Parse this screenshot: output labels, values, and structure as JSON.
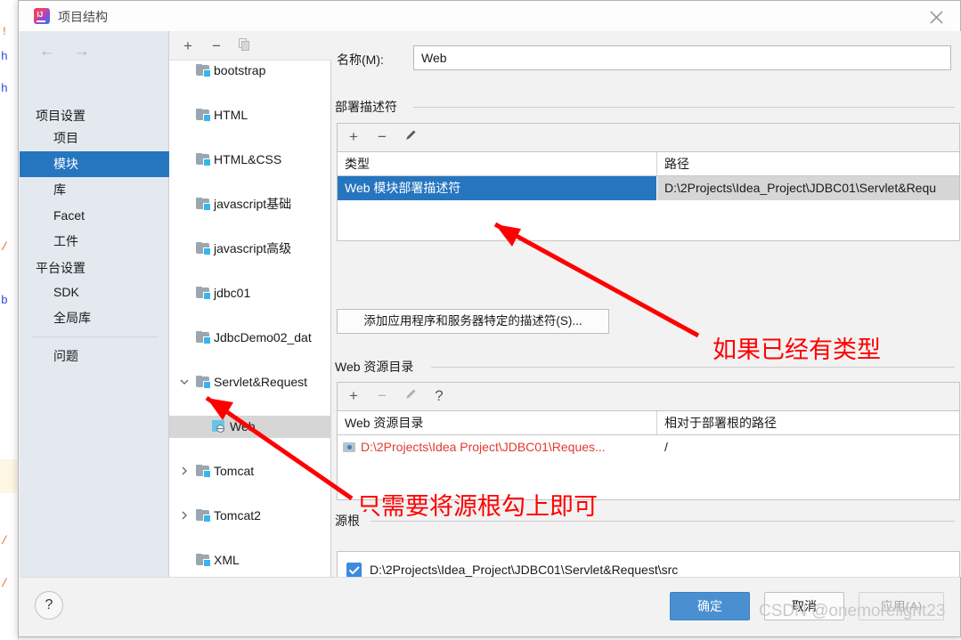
{
  "window": {
    "title": "项目结构",
    "app_icon": "intellij-idea-icon",
    "close_icon": "close-icon"
  },
  "sidebar": {
    "back_icon": "arrow-left-icon",
    "forward_icon": "arrow-right-icon",
    "groups": [
      {
        "label": "项目设置",
        "items": [
          "项目",
          "模块",
          "库",
          "Facet",
          "工件"
        ]
      },
      {
        "label": "平台设置",
        "items": [
          "SDK",
          "全局库"
        ]
      }
    ],
    "selected": "模块",
    "footer_item": "问题"
  },
  "tree": {
    "toolbar": {
      "add": "+",
      "remove": "−",
      "copy_icon": "copy-icon"
    },
    "items": [
      {
        "label": "bootstrap",
        "type": "module",
        "depth": 0,
        "twisty": "none"
      },
      {
        "label": "HTML",
        "type": "module",
        "depth": 0,
        "twisty": "none"
      },
      {
        "label": "HTML&CSS",
        "type": "module",
        "depth": 0,
        "twisty": "none"
      },
      {
        "label": "javascript基础",
        "type": "module",
        "depth": 0,
        "twisty": "none"
      },
      {
        "label": "javascript高级",
        "type": "module",
        "depth": 0,
        "twisty": "none"
      },
      {
        "label": "jdbc01",
        "type": "module",
        "depth": 0,
        "twisty": "none"
      },
      {
        "label": "JdbcDemo02_dat",
        "type": "module",
        "depth": 0,
        "twisty": "none"
      },
      {
        "label": "Servlet&Request",
        "type": "module",
        "depth": 0,
        "twisty": "expanded"
      },
      {
        "label": "Web",
        "type": "facet",
        "depth": 1,
        "twisty": "none",
        "selected": true
      },
      {
        "label": "Tomcat",
        "type": "module",
        "depth": 0,
        "twisty": "collapsed"
      },
      {
        "label": "Tomcat2",
        "type": "module",
        "depth": 0,
        "twisty": "collapsed"
      },
      {
        "label": "XML",
        "type": "module",
        "depth": 0,
        "twisty": "none"
      }
    ]
  },
  "main": {
    "name_label": "名称(M):",
    "name_value": "Web",
    "deployment": {
      "section_label": "部署描述符",
      "toolbar": {
        "add": "+",
        "remove": "−",
        "edit_icon": "pencil-icon"
      },
      "columns": [
        "类型",
        "路径"
      ],
      "rows": [
        {
          "type": "Web 模块部署描述符",
          "path": "D:\\2Projects\\Idea_Project\\JDBC01\\Servlet&Requ",
          "selected": true
        }
      ],
      "add_descriptor_button": "添加应用程序和服务器特定的描述符(S)..."
    },
    "web_resources": {
      "section_label": "Web 资源目录",
      "toolbar": {
        "add": "+",
        "remove": "−",
        "edit_icon": "pencil-icon",
        "help": "?"
      },
      "columns": [
        "Web 资源目录",
        "相对于部署根的路径"
      ],
      "rows": [
        {
          "directory": "D:\\2Projects\\Idea Project\\JDBC01\\Reques...",
          "relative_path": "/",
          "error": true
        }
      ]
    },
    "source_roots": {
      "section_label": "源根",
      "rows": [
        {
          "checked": true,
          "path": "D:\\2Projects\\Idea_Project\\JDBC01\\Servlet&Request\\src"
        }
      ]
    }
  },
  "annotations": [
    {
      "text": "如果已经有类型",
      "color": "#ff0000"
    },
    {
      "text": "只需要将源根勾上即可",
      "color": "#ff0000"
    }
  ],
  "footer": {
    "help_icon": "question-mark-icon",
    "ok_label": "确定",
    "cancel_label": "取消",
    "apply_label": "应用(A)"
  },
  "watermark": "CSDN @onemorelight23",
  "background_code": [
    "!",
    "h",
    "h",
    "/",
    "b",
    "/",
    "/"
  ]
}
